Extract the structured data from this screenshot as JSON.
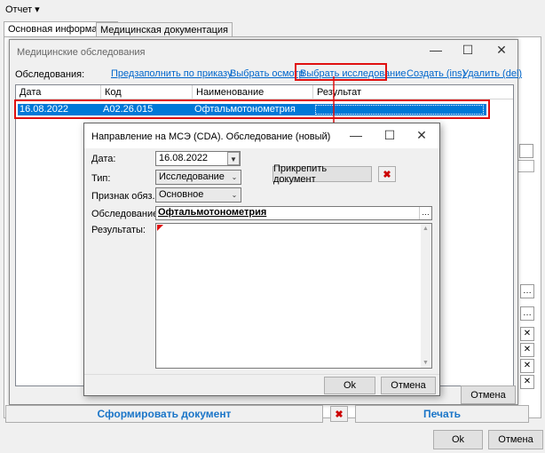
{
  "menu": {
    "report_label": "Отчет ▾"
  },
  "tabs": [
    "Основная информация",
    "Медицинская документация"
  ],
  "exams_window": {
    "title": "Медицинские обследования",
    "label": "Обследования:",
    "links": {
      "prefill": "Предзаполнить по приказу",
      "choose_exam": "Выбрать осмотр",
      "choose_study": "Выбрать исследование",
      "create": "Создать (ins)",
      "delete": "Удалить (del)"
    },
    "columns": [
      "Дата",
      "Код",
      "Наименование",
      "Результат"
    ],
    "rows": [
      {
        "date": "16.08.2022",
        "code": "A02.26.015",
        "name": "Офтальмотонометрия",
        "result": ""
      }
    ],
    "cancel": "Отмена"
  },
  "dialog": {
    "title": "Направление на МСЭ (CDA). Обследование (новый)",
    "date_label": "Дата:",
    "date_value": "16.08.2022",
    "type_label": "Тип:",
    "type_value": "Исследование",
    "sign_label": "Признак обяз.:",
    "sign_value": "Основное",
    "exam_label": "Обследование:",
    "exam_value": "Офтальмотонометрия",
    "results_label": "Результаты:",
    "attach_button": "Прикрепить документ",
    "ok": "Ok",
    "cancel": "Отмена"
  },
  "bottom": {
    "form_doc": "Сформировать документ",
    "print": "Печать",
    "ok": "Ok",
    "cancel": "Отмена"
  },
  "colors": {
    "selection": "#0078d7",
    "link": "#0066cc",
    "highlight": "#e01010"
  }
}
